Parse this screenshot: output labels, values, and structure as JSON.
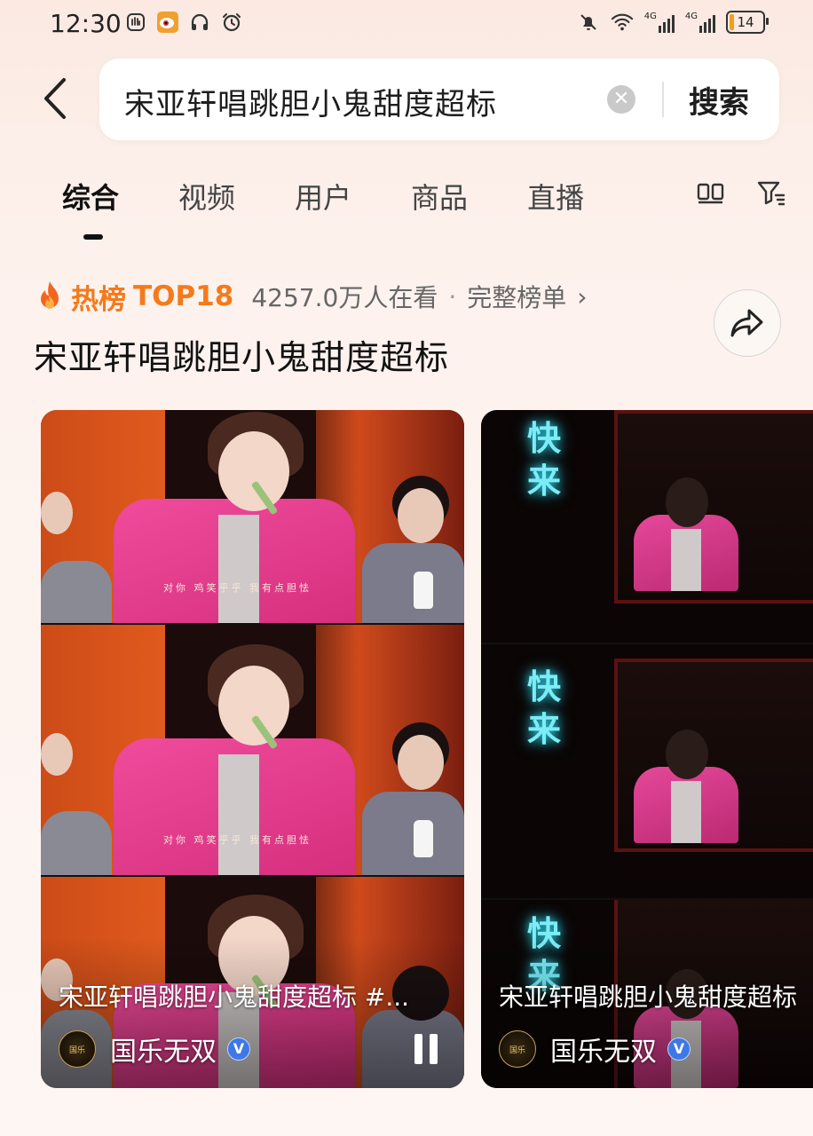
{
  "status_bar": {
    "time": "12:30",
    "network_1": "4G",
    "network_2": "4G",
    "battery": "14"
  },
  "search": {
    "query": "宋亚轩唱跳胆小鬼甜度超标",
    "button_label": "搜索"
  },
  "tabs": [
    {
      "label": "综合",
      "active": true
    },
    {
      "label": "视频",
      "active": false
    },
    {
      "label": "用户",
      "active": false
    },
    {
      "label": "商品",
      "active": false
    },
    {
      "label": "直播",
      "active": false
    }
  ],
  "hot": {
    "label": "热榜",
    "rank": "TOP18",
    "viewers": "4257.0万人在看",
    "separator": "·",
    "full_list": "完整榜单",
    "chevron": "›",
    "headline": "宋亚轩唱跳胆小鬼甜度超标"
  },
  "videos": [
    {
      "title": "宋亚轩唱跳胆小鬼甜度超标 #...",
      "author": "国乐无双",
      "verified": "V",
      "subtitle_text": "对你    鸡笑乎乎    我有点胆怯"
    },
    {
      "title": "宋亚轩唱跳胆小鬼甜度超标",
      "author": "国乐无双",
      "verified": "V",
      "neon_text": "快来"
    }
  ],
  "colors": {
    "accent_orange": "#f47a1c",
    "verified_blue": "#3d78e6",
    "neon_cyan": "#7cecf6"
  },
  "icons": {
    "back": "chevron-left-icon",
    "clear": "clear-icon",
    "layout": "two-column-icon",
    "filter": "filter-icon",
    "share": "share-icon",
    "fire": "fire-icon",
    "pause": "pause-icon"
  }
}
